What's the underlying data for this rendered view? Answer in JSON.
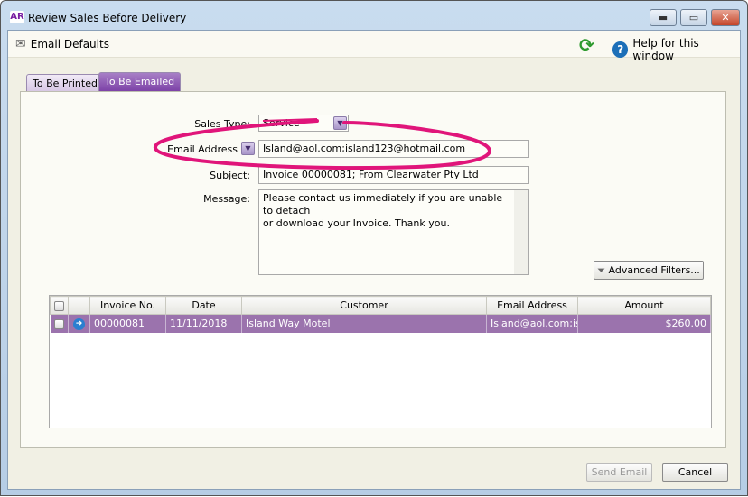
{
  "window": {
    "logo": "AR",
    "title": "Review Sales Before Delivery",
    "minimize": "▬",
    "maximize": "▭",
    "close": "✕"
  },
  "toolbar": {
    "email_defaults": "Email Defaults",
    "help": "Help for this window"
  },
  "tabs": [
    {
      "label": "To Be Printed",
      "active": false
    },
    {
      "label": "To Be Emailed",
      "active": true
    }
  ],
  "form": {
    "sales_type_label": "Sales Type:",
    "sales_type_value": "Service",
    "email_label": "Email Address",
    "email_value": "Island@aol.com;island123@hotmail.com",
    "subject_label": "Subject:",
    "subject_value": "Invoice 00000081; From Clearwater Pty Ltd",
    "message_label": "Message:",
    "message_value": "Please contact us immediately if you are unable to detach\nor download your Invoice. Thank you."
  },
  "advanced_filters": "Advanced Filters...",
  "table": {
    "columns": [
      "",
      "",
      "Invoice No.",
      "Date",
      "Customer",
      "Email Address",
      "Amount"
    ],
    "rows": [
      {
        "invoice": "00000081",
        "date": "11/11/2018",
        "customer": "Island Way Motel",
        "email": "Island@aol.com;isla",
        "amount": "$260.00"
      }
    ]
  },
  "buttons": {
    "send": "Send Email",
    "cancel": "Cancel"
  },
  "colors": {
    "accent": "#8a4cb0",
    "selected_row": "#9b73ad",
    "annotation": "#e0157a"
  }
}
